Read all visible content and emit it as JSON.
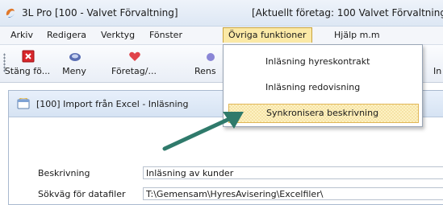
{
  "app": {
    "title": "3L Pro  [100 - Valvet Förvaltning]",
    "company": "[Aktuellt företag: 100 Valvet Förvaltning"
  },
  "menu": {
    "items": [
      {
        "label": "Arkiv"
      },
      {
        "label": "Redigera"
      },
      {
        "label": "Verktyg"
      },
      {
        "label": "Fönster"
      },
      {
        "label": "Övriga funktioner"
      },
      {
        "label": "Hjälp m.m"
      }
    ]
  },
  "toolbar": {
    "buttons": [
      {
        "label": "Stäng fö...",
        "icon": "close-icon"
      },
      {
        "label": "Meny",
        "icon": "menu-icon"
      },
      {
        "label": "Företag/...",
        "icon": "heart-icon"
      },
      {
        "label": "Rens",
        "icon": "clean-icon"
      },
      {
        "label": "In",
        "icon": "import-icon"
      }
    ]
  },
  "dropdown": {
    "items": [
      {
        "label": "Inläsning hyreskontrakt"
      },
      {
        "label": "Inläsning redovisning"
      },
      {
        "label": "Synkronisera beskrivning",
        "selected": true
      }
    ]
  },
  "subwindow": {
    "title": "[100]  Import från Excel - Inläsning",
    "fields": [
      {
        "label": "Beskrivning",
        "value": "Inläsning av kunder"
      },
      {
        "label": "Sökväg för datafiler",
        "value": "T:\\Gemensam\\HyresAvisering\\Excelfiler\\"
      }
    ]
  },
  "colors": {
    "menu_highlight": "#fbe9a6",
    "selected_item": "#fdf1c3",
    "arrow": "#2f7a6b"
  }
}
